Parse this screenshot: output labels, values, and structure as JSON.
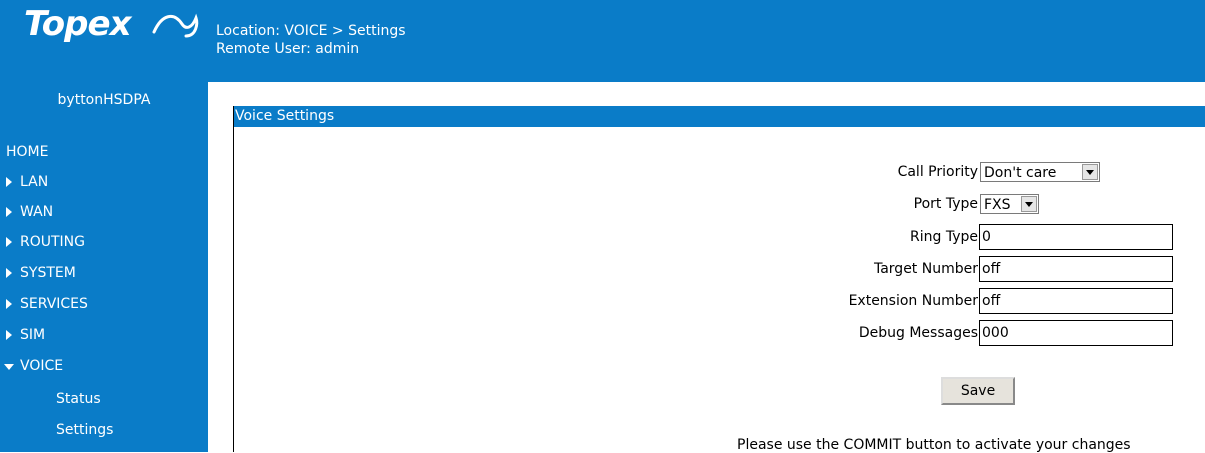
{
  "sidebar": {
    "logo_text": "Topex",
    "device_name": "byttonHSDPA",
    "items": [
      {
        "label": "HOME"
      },
      {
        "label": "LAN"
      },
      {
        "label": "WAN"
      },
      {
        "label": "ROUTING"
      },
      {
        "label": "SYSTEM"
      },
      {
        "label": "SERVICES"
      },
      {
        "label": "SIM"
      },
      {
        "label": "VOICE"
      }
    ],
    "voice_subitems": [
      {
        "label": "Status"
      },
      {
        "label": "Settings"
      }
    ]
  },
  "header": {
    "location": "Location: VOICE > Settings",
    "remote_user": "Remote User: admin"
  },
  "panel": {
    "title": "Voice Settings",
    "fields": {
      "call_priority": {
        "label": "Call Priority",
        "value": "Don't care"
      },
      "port_type": {
        "label": "Port Type",
        "value": "FXS"
      },
      "ring_type": {
        "label": "Ring Type",
        "value": "0"
      },
      "target_number": {
        "label": "Target Number",
        "value": "off"
      },
      "extension_number": {
        "label": "Extension Number",
        "value": "off"
      },
      "debug_messages": {
        "label": "Debug Messages",
        "value": "000"
      }
    },
    "save_label": "Save",
    "commit_note": "Please use the COMMIT button to activate your changes"
  },
  "colors": {
    "brand_blue": "#0a7cc8"
  }
}
